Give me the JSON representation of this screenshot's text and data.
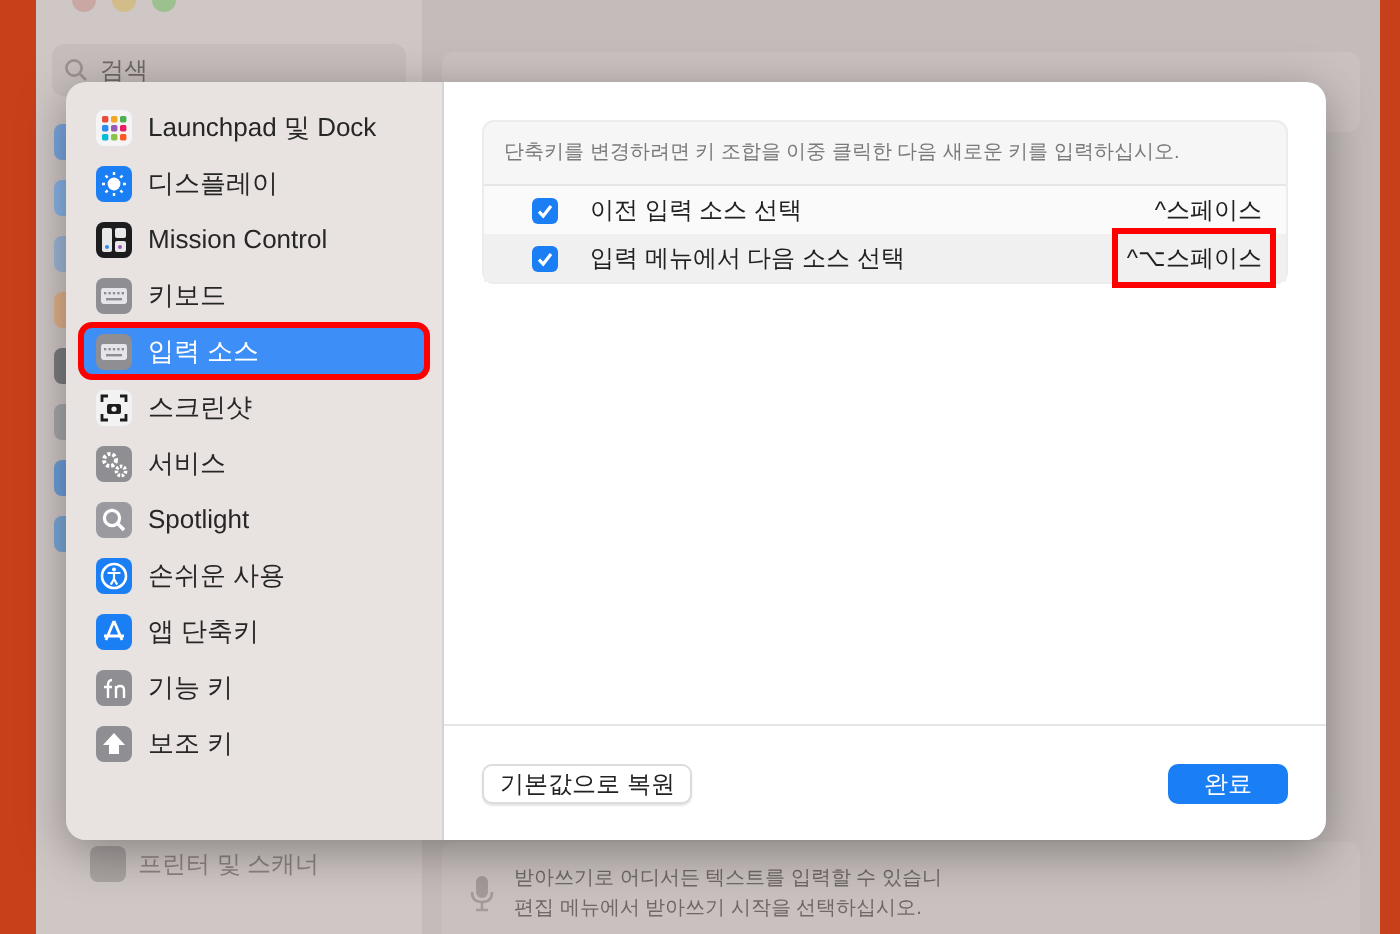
{
  "background_window": {
    "search": {
      "placeholder": "검색"
    },
    "sidebar_items": [
      {
        "label": "프린터 및 스캐너"
      }
    ],
    "dictation": [
      "받아쓰기로 어디서든 텍스트를 입력할 수 있습니",
      "편집 메뉴에서 받아쓰기 시작을 선택하십시오."
    ]
  },
  "sheet": {
    "sidebar": [
      {
        "label": "Launchpad 및 Dock",
        "kind": "launchpad",
        "selected": false,
        "highlighted": false
      },
      {
        "label": "디스플레이",
        "kind": "display",
        "selected": false,
        "highlighted": false
      },
      {
        "label": "Mission Control",
        "kind": "mission",
        "selected": false,
        "highlighted": false
      },
      {
        "label": "키보드",
        "kind": "keyboard",
        "selected": false,
        "highlighted": false
      },
      {
        "label": "입력 소스",
        "kind": "keyboard",
        "selected": true,
        "highlighted": true
      },
      {
        "label": "스크린샷",
        "kind": "screenshot",
        "selected": false,
        "highlighted": false
      },
      {
        "label": "서비스",
        "kind": "services",
        "selected": false,
        "highlighted": false
      },
      {
        "label": "Spotlight",
        "kind": "spotlight",
        "selected": false,
        "highlighted": false
      },
      {
        "label": "손쉬운 사용",
        "kind": "accessibility",
        "selected": false,
        "highlighted": false
      },
      {
        "label": "앱 단축키",
        "kind": "appstore",
        "selected": false,
        "highlighted": false
      },
      {
        "label": "기능 키",
        "kind": "fn",
        "selected": false,
        "highlighted": false
      },
      {
        "label": "보조 키",
        "kind": "modifier",
        "selected": false,
        "highlighted": false
      }
    ],
    "hint": "단축키를 변경하려면 키 조합을 이중 클릭한 다음 새로운 키를 입력하십시오.",
    "shortcuts": [
      {
        "label": "이전 입력 소스 선택",
        "keys": "^스페이스",
        "checked": true,
        "highlighted": false
      },
      {
        "label": "입력 메뉴에서 다음 소스 선택",
        "keys": "^⌥스페이스",
        "checked": true,
        "highlighted": true
      }
    ],
    "buttons": {
      "restore": "기본값으로 복원",
      "done": "완료"
    }
  }
}
